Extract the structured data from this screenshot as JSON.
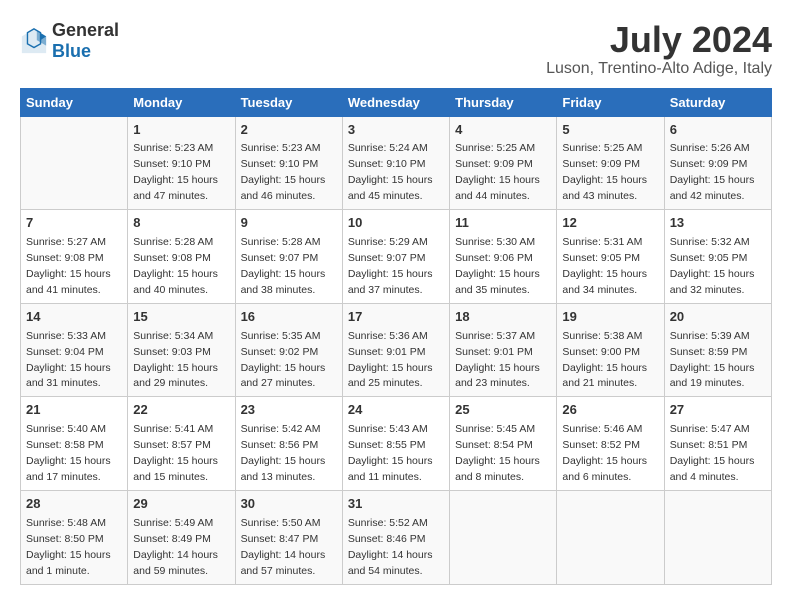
{
  "header": {
    "logo_general": "General",
    "logo_blue": "Blue",
    "title": "July 2024",
    "subtitle": "Luson, Trentino-Alto Adige, Italy"
  },
  "days_of_week": [
    "Sunday",
    "Monday",
    "Tuesday",
    "Wednesday",
    "Thursday",
    "Friday",
    "Saturday"
  ],
  "weeks": [
    [
      {
        "day": "",
        "info": ""
      },
      {
        "day": "1",
        "info": "Sunrise: 5:23 AM\nSunset: 9:10 PM\nDaylight: 15 hours\nand 47 minutes."
      },
      {
        "day": "2",
        "info": "Sunrise: 5:23 AM\nSunset: 9:10 PM\nDaylight: 15 hours\nand 46 minutes."
      },
      {
        "day": "3",
        "info": "Sunrise: 5:24 AM\nSunset: 9:10 PM\nDaylight: 15 hours\nand 45 minutes."
      },
      {
        "day": "4",
        "info": "Sunrise: 5:25 AM\nSunset: 9:09 PM\nDaylight: 15 hours\nand 44 minutes."
      },
      {
        "day": "5",
        "info": "Sunrise: 5:25 AM\nSunset: 9:09 PM\nDaylight: 15 hours\nand 43 minutes."
      },
      {
        "day": "6",
        "info": "Sunrise: 5:26 AM\nSunset: 9:09 PM\nDaylight: 15 hours\nand 42 minutes."
      }
    ],
    [
      {
        "day": "7",
        "info": "Sunrise: 5:27 AM\nSunset: 9:08 PM\nDaylight: 15 hours\nand 41 minutes."
      },
      {
        "day": "8",
        "info": "Sunrise: 5:28 AM\nSunset: 9:08 PM\nDaylight: 15 hours\nand 40 minutes."
      },
      {
        "day": "9",
        "info": "Sunrise: 5:28 AM\nSunset: 9:07 PM\nDaylight: 15 hours\nand 38 minutes."
      },
      {
        "day": "10",
        "info": "Sunrise: 5:29 AM\nSunset: 9:07 PM\nDaylight: 15 hours\nand 37 minutes."
      },
      {
        "day": "11",
        "info": "Sunrise: 5:30 AM\nSunset: 9:06 PM\nDaylight: 15 hours\nand 35 minutes."
      },
      {
        "day": "12",
        "info": "Sunrise: 5:31 AM\nSunset: 9:05 PM\nDaylight: 15 hours\nand 34 minutes."
      },
      {
        "day": "13",
        "info": "Sunrise: 5:32 AM\nSunset: 9:05 PM\nDaylight: 15 hours\nand 32 minutes."
      }
    ],
    [
      {
        "day": "14",
        "info": "Sunrise: 5:33 AM\nSunset: 9:04 PM\nDaylight: 15 hours\nand 31 minutes."
      },
      {
        "day": "15",
        "info": "Sunrise: 5:34 AM\nSunset: 9:03 PM\nDaylight: 15 hours\nand 29 minutes."
      },
      {
        "day": "16",
        "info": "Sunrise: 5:35 AM\nSunset: 9:02 PM\nDaylight: 15 hours\nand 27 minutes."
      },
      {
        "day": "17",
        "info": "Sunrise: 5:36 AM\nSunset: 9:01 PM\nDaylight: 15 hours\nand 25 minutes."
      },
      {
        "day": "18",
        "info": "Sunrise: 5:37 AM\nSunset: 9:01 PM\nDaylight: 15 hours\nand 23 minutes."
      },
      {
        "day": "19",
        "info": "Sunrise: 5:38 AM\nSunset: 9:00 PM\nDaylight: 15 hours\nand 21 minutes."
      },
      {
        "day": "20",
        "info": "Sunrise: 5:39 AM\nSunset: 8:59 PM\nDaylight: 15 hours\nand 19 minutes."
      }
    ],
    [
      {
        "day": "21",
        "info": "Sunrise: 5:40 AM\nSunset: 8:58 PM\nDaylight: 15 hours\nand 17 minutes."
      },
      {
        "day": "22",
        "info": "Sunrise: 5:41 AM\nSunset: 8:57 PM\nDaylight: 15 hours\nand 15 minutes."
      },
      {
        "day": "23",
        "info": "Sunrise: 5:42 AM\nSunset: 8:56 PM\nDaylight: 15 hours\nand 13 minutes."
      },
      {
        "day": "24",
        "info": "Sunrise: 5:43 AM\nSunset: 8:55 PM\nDaylight: 15 hours\nand 11 minutes."
      },
      {
        "day": "25",
        "info": "Sunrise: 5:45 AM\nSunset: 8:54 PM\nDaylight: 15 hours\nand 8 minutes."
      },
      {
        "day": "26",
        "info": "Sunrise: 5:46 AM\nSunset: 8:52 PM\nDaylight: 15 hours\nand 6 minutes."
      },
      {
        "day": "27",
        "info": "Sunrise: 5:47 AM\nSunset: 8:51 PM\nDaylight: 15 hours\nand 4 minutes."
      }
    ],
    [
      {
        "day": "28",
        "info": "Sunrise: 5:48 AM\nSunset: 8:50 PM\nDaylight: 15 hours\nand 1 minute."
      },
      {
        "day": "29",
        "info": "Sunrise: 5:49 AM\nSunset: 8:49 PM\nDaylight: 14 hours\nand 59 minutes."
      },
      {
        "day": "30",
        "info": "Sunrise: 5:50 AM\nSunset: 8:47 PM\nDaylight: 14 hours\nand 57 minutes."
      },
      {
        "day": "31",
        "info": "Sunrise: 5:52 AM\nSunset: 8:46 PM\nDaylight: 14 hours\nand 54 minutes."
      },
      {
        "day": "",
        "info": ""
      },
      {
        "day": "",
        "info": ""
      },
      {
        "day": "",
        "info": ""
      }
    ]
  ]
}
